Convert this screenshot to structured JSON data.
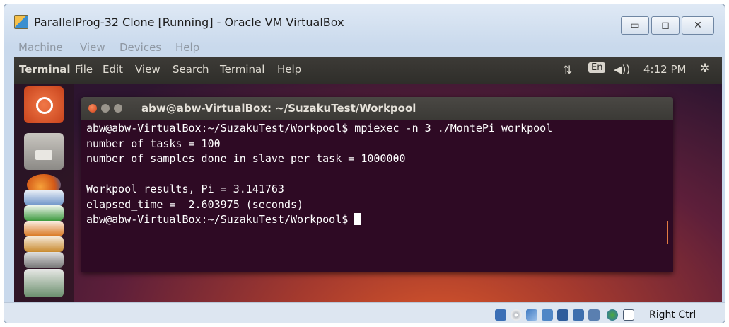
{
  "window": {
    "title": "ParallelProg-32 Clone [Running] - Oracle VM VirtualBox",
    "buttons": {
      "minimize": "▭",
      "maximize": "◻",
      "close": "✕"
    }
  },
  "vbox_menu": [
    "Machine",
    "View",
    "Devices",
    "Help"
  ],
  "guest_topbar": {
    "app_name": "Terminal",
    "menu": [
      "File",
      "Edit",
      "View",
      "Search",
      "Terminal",
      "Help"
    ],
    "keyboard_indicator": "En",
    "clock": "4:12 PM"
  },
  "terminal": {
    "title": "abw@abw-VirtualBox: ~/SuzakuTest/Workpool",
    "lines": [
      "abw@abw-VirtualBox:~/SuzakuTest/Workpool$ mpiexec -n 3 ./MontePi_workpool",
      "number of tasks = 100",
      "number of samples done in slave per task = 1000000",
      "",
      "Workpool results, Pi = 3.141763",
      "elapsed_time =  2.603975 (seconds)"
    ],
    "prompt": "abw@abw-VirtualBox:~/SuzakuTest/Workpool$ "
  },
  "statusbar": {
    "host_key": "Right Ctrl"
  },
  "icons": [
    "ubuntu-dash-icon",
    "files-icon",
    "firefox-icon",
    "libreoffice-writer-icon",
    "libreoffice-calc-icon",
    "libreoffice-impress-icon",
    "software-center-icon",
    "settings-icon",
    "trash-icon"
  ],
  "colors": {
    "terminal_bg": "#2e0a24",
    "accent_orange": "#dd4814",
    "topbar_bg": "#3c3b37"
  }
}
